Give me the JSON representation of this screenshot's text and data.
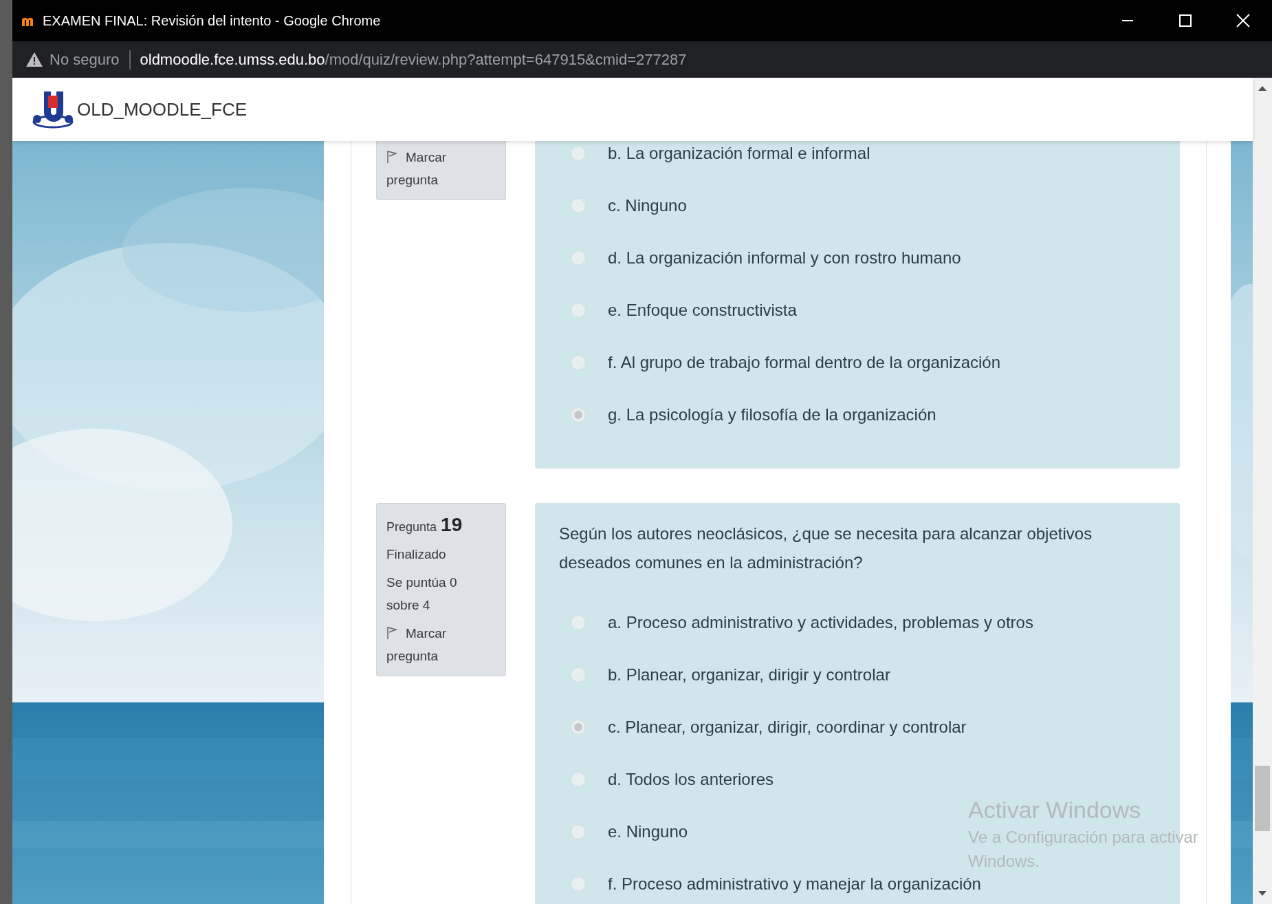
{
  "window": {
    "title": "EXAMEN FINAL: Revisión del intento - Google Chrome"
  },
  "address_bar": {
    "security": "No seguro",
    "domain": "oldmoodle.fce.umss.edu.bo",
    "path": "/mod/quiz/review.php?attempt=647915&cmid=277287"
  },
  "site": {
    "name": "OLD_MOODLE_FCE"
  },
  "questions": [
    {
      "info": [
        {
          "kind": "flag",
          "text": "Marcar pregunta"
        }
      ],
      "options": [
        {
          "label": "b. La organización formal e informal",
          "selected": false
        },
        {
          "label": "c. Ninguno",
          "selected": false
        },
        {
          "label": "d. La organización informal y con rostro humano",
          "selected": false
        },
        {
          "label": "e. Enfoque constructivista",
          "selected": false
        },
        {
          "label": "f. Al grupo de trabajo formal dentro de la organización",
          "selected": false
        },
        {
          "label": "g. La psicología y filosofía de la organización",
          "selected": true
        }
      ]
    },
    {
      "info": [
        {
          "kind": "number",
          "label": "Pregunta",
          "text": "19"
        },
        {
          "kind": "status",
          "text": "Finalizado"
        },
        {
          "kind": "grade",
          "text": "Se puntúa 0 sobre 4"
        },
        {
          "kind": "flag",
          "text": "Marcar pregunta"
        }
      ],
      "prompt": "Según los autores neoclásicos, ¿que se necesita para alcanzar objetivos deseados comunes en la administración?",
      "options": [
        {
          "label": "a. Proceso administrativo y actividades, problemas y otros",
          "selected": false
        },
        {
          "label": "b. Planear, organizar, dirigir y controlar",
          "selected": false
        },
        {
          "label": "c. Planear, organizar, dirigir, coordinar y controlar",
          "selected": true
        },
        {
          "label": "d. Todos los anteriores",
          "selected": false
        },
        {
          "label": "e. Ninguno",
          "selected": false
        },
        {
          "label": "f. Proceso administrativo y manejar la organización",
          "selected": false
        }
      ]
    }
  ],
  "os_notice": {
    "title": "Activar Windows",
    "message": "Ve a Configuración para activar Windows."
  }
}
